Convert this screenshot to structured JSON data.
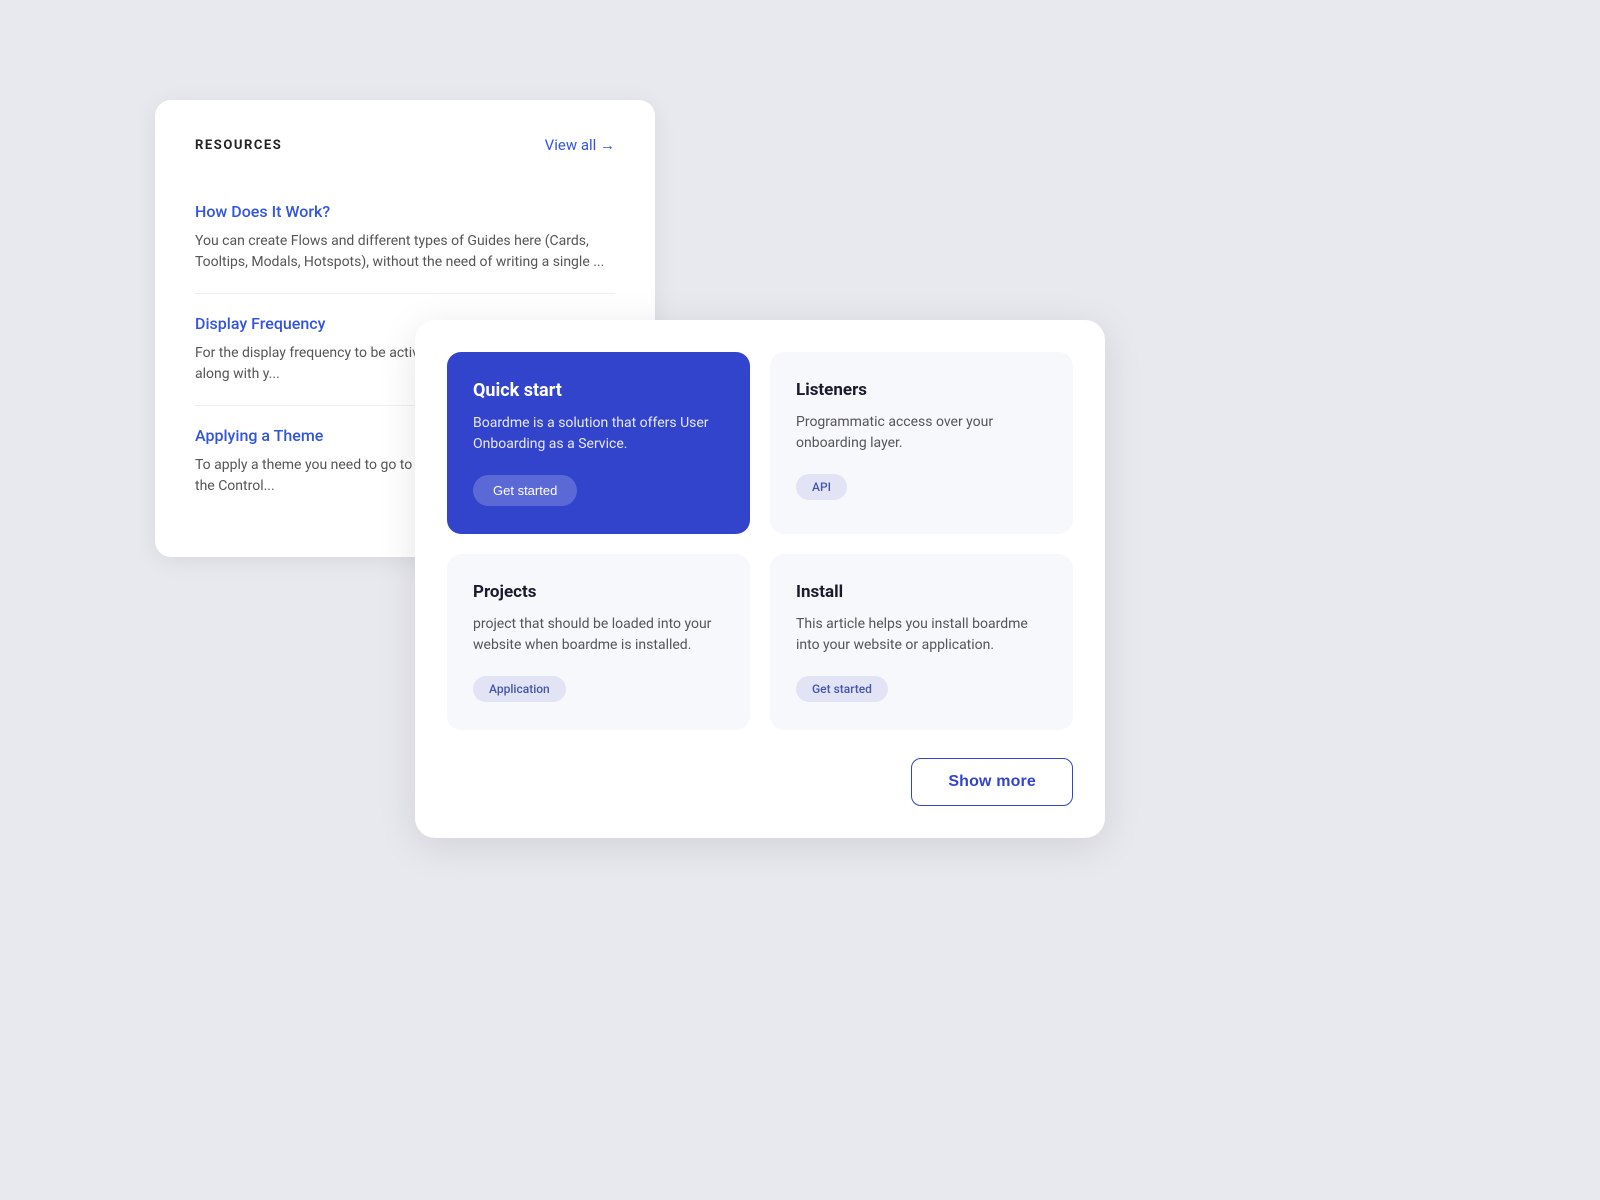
{
  "resources": {
    "title": "RESOURCES",
    "view_all_label": "View all →",
    "items": [
      {
        "title": "How Does It Work?",
        "description": "You can create Flows and different types of Guides here (Cards, Tooltips, Modals, Hotspots), without the need of writing a single ..."
      },
      {
        "title": "Display Frequency",
        "description": "For the display frequency to be activa... tracking. That means that along with y..."
      },
      {
        "title": "Applying a Theme",
        "description": "To apply a theme you need to go to th... theme of your choice from the Control..."
      }
    ]
  },
  "main_grid": {
    "cards": [
      {
        "id": "quickstart",
        "title": "Quick start",
        "description": "Boardme is a solution that offers User Onboarding as a Service.",
        "tag": "Get started",
        "style": "blue"
      },
      {
        "id": "listeners",
        "title": "Listeners",
        "description": "Programmatic access over your onboarding layer.",
        "tag": "API",
        "style": "white"
      },
      {
        "id": "projects",
        "title": "Projects",
        "description": "project that should be loaded into your website when boardme is installed.",
        "tag": "Application",
        "style": "white"
      },
      {
        "id": "install",
        "title": "Install",
        "description": "This article helps you install boardme into your website or application.",
        "tag": "Get started",
        "style": "white"
      }
    ],
    "show_more_label": "Show more"
  }
}
